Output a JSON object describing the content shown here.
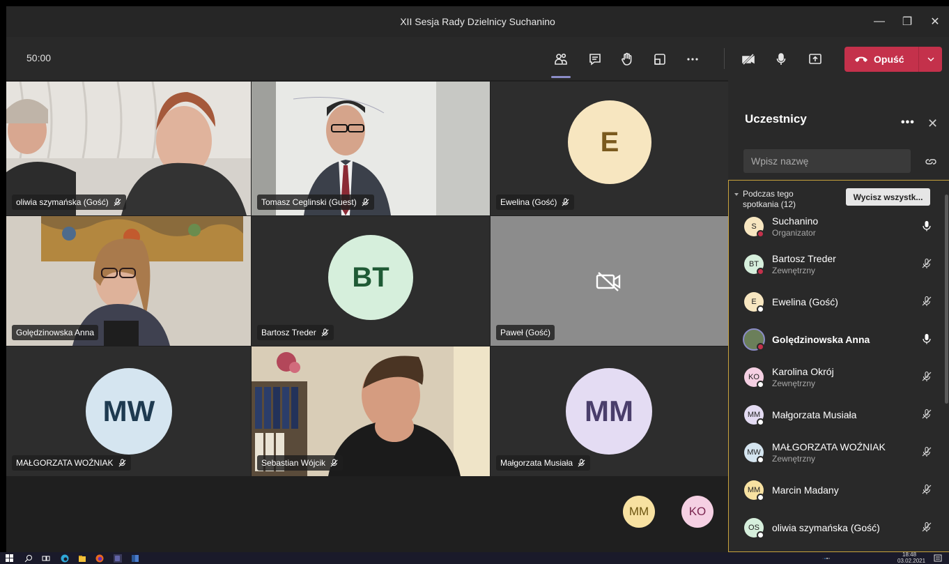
{
  "window": {
    "title": "XII Sesja Rady Dzielnicy Suchanino",
    "minimize": "—",
    "maximize": "❐",
    "close": "✕"
  },
  "toolbar": {
    "timer": "50:00",
    "leave_label": "Opuść",
    "icons": [
      "people-icon",
      "chat-icon",
      "raise-hand-icon",
      "rooms-icon",
      "more-icon",
      "camera-off-icon",
      "mic-icon",
      "share-icon"
    ]
  },
  "grid": {
    "tiles": [
      {
        "name": "oliwia szymańska (Gość)",
        "type": "video"
      },
      {
        "name": "Tomasz Ceglinski (Guest)",
        "type": "video"
      },
      {
        "name": "Ewelina (Gość)",
        "type": "avatar",
        "initials": "E",
        "color": "#f7e6c0"
      },
      {
        "name": "Golędzinowska Anna",
        "type": "video"
      },
      {
        "name": "Bartosz Treder",
        "type": "avatar",
        "initials": "BT",
        "color": "#d6efdc"
      },
      {
        "name": "Paweł (Gość)",
        "type": "camera-off"
      },
      {
        "name": "MAŁGORZATA WOŹNIAK",
        "type": "avatar",
        "initials": "MW",
        "color": "#d5e5f0"
      },
      {
        "name": "Sebastian Wójcik",
        "type": "video"
      },
      {
        "name": "Małgorzata Musiała",
        "type": "avatar",
        "initials": "MM",
        "color": "#e4dcf3"
      }
    ],
    "overflow": [
      {
        "initials": "MM",
        "color": "#f7e1a1"
      },
      {
        "initials": "KO",
        "color": "#f5d0e3"
      }
    ]
  },
  "panel": {
    "title": "Uczestnicy",
    "more": "•••",
    "close": "✕",
    "search_placeholder": "Wpisz nazwę",
    "section_label": "Podczas tego spotkania (12)",
    "mute_all": "Wycisz wszystk...",
    "participants": [
      {
        "initials": "S",
        "name": "Suchanino",
        "role": "Organizator",
        "color": "#f7e6c0",
        "mic": "on",
        "status": "#c4314b"
      },
      {
        "initials": "BT",
        "name": "Bartosz Treder",
        "role": "Zewnętrzny",
        "color": "#d6efdc",
        "mic": "off",
        "status": "#c4314b"
      },
      {
        "initials": "E",
        "name": "Ewelina (Gość)",
        "role": "",
        "color": "#f7e6c0",
        "mic": "off",
        "status": "#ffffff"
      },
      {
        "initials": "",
        "name": "Golędzinowska Anna",
        "role": "",
        "color": "#6b7f5a",
        "mic": "on",
        "status": "#c4314b"
      },
      {
        "initials": "KO",
        "name": "Karolina Okrój",
        "role": "Zewnętrzny",
        "color": "#f5d0e3",
        "mic": "off",
        "status": "#ffffff"
      },
      {
        "initials": "MM",
        "name": "Małgorzata Musiała",
        "role": "",
        "color": "#e4dcf3",
        "mic": "off",
        "status": "#ffffff"
      },
      {
        "initials": "MW",
        "name": "MAŁGORZATA WOŹNIAK",
        "role": "Zewnętrzny",
        "color": "#d5e5f0",
        "mic": "off",
        "status": "#ffffff"
      },
      {
        "initials": "MM",
        "name": "Marcin Madany",
        "role": "",
        "color": "#f7e1a1",
        "mic": "off",
        "status": "#ffffff"
      },
      {
        "initials": "OS",
        "name": "oliwia szymańska (Gość)",
        "role": "",
        "color": "#d6efdc",
        "mic": "off",
        "status": "#ffffff"
      }
    ]
  },
  "taskbar": {
    "time": "18:48",
    "date": "03.02.2021"
  },
  "colors": {
    "accent": "#8b8cc7",
    "leave": "#c4314b",
    "highlight_border": "#c8a33c"
  }
}
